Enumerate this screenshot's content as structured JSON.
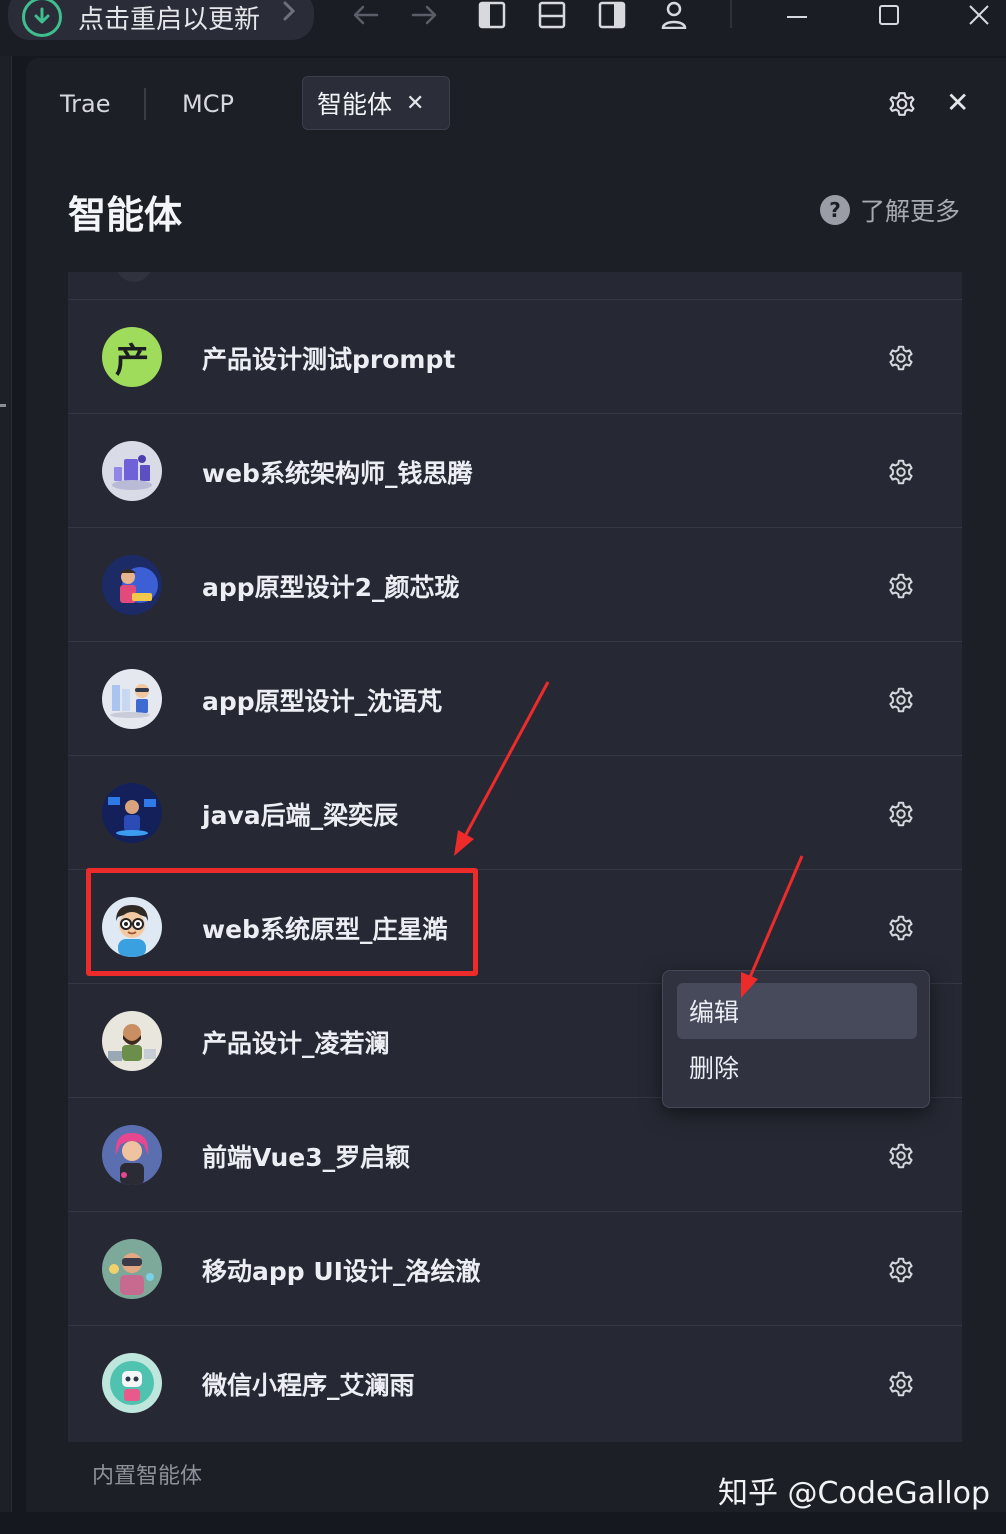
{
  "titlebar": {
    "update_label": "点击重启以更新",
    "icons": [
      "download-icon",
      "chevron-right-icon",
      "back-arrow-icon",
      "forward-arrow-icon",
      "layout-left-icon",
      "layout-bottom-icon",
      "layout-right-icon",
      "account-icon",
      "minimize-icon",
      "maximize-icon",
      "close-icon"
    ]
  },
  "tabs": [
    {
      "label": "Trae",
      "active": false
    },
    {
      "label": "MCP",
      "active": false
    },
    {
      "label": "智能体",
      "active": true
    }
  ],
  "header": {
    "title": "智能体",
    "learn_more": "了解更多",
    "help_glyph": "?"
  },
  "agents": [
    {
      "name": "产品设计测试prompt",
      "avatar_text": "产",
      "avatar_color": "#9fdc5c"
    },
    {
      "name": "web系统架构师_钱思腾",
      "avatar_icon": "architect-avatar-icon"
    },
    {
      "name": "app原型设计2_颜芯珑",
      "avatar_icon": "designer-avatar-icon"
    },
    {
      "name": "app原型设计_沈语芃",
      "avatar_icon": "prototype-avatar-icon"
    },
    {
      "name": "java后端_梁奕辰",
      "avatar_icon": "developer-avatar-icon"
    },
    {
      "name": "web系统原型_庄星澔",
      "avatar_icon": "boy-glasses-avatar-icon",
      "highlighted": true
    },
    {
      "name": "产品设计_凌若澜",
      "avatar_icon": "bearded-man-avatar-icon"
    },
    {
      "name": "前端Vue3_罗启颖",
      "avatar_icon": "pink-hair-avatar-icon"
    },
    {
      "name": "移动app UI设计_洛绘澈",
      "avatar_icon": "vr-avatar-icon"
    },
    {
      "name": "微信小程序_艾澜雨",
      "avatar_icon": "robot-avatar-icon"
    }
  ],
  "context_menu": {
    "items": [
      {
        "label": "编辑",
        "hover": true
      },
      {
        "label": "删除",
        "hover": false
      }
    ]
  },
  "builtin_section": "内置智能体",
  "watermark": "知乎 @CodeGallop",
  "colors": {
    "background": "#16181f",
    "panel": "#1d1f27",
    "list": "#262933",
    "annotation_red": "#ee2b2b",
    "update_green": "#3fbf8f"
  }
}
